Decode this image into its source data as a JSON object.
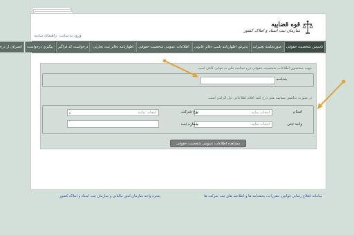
{
  "header": {
    "logo_title": "قوه قضاییه",
    "logo_subtitle": "سازمان ثبت اسناد و املاک کشور"
  },
  "toplinks": {
    "login": "ورود به سایت",
    "help": "راهنمای سایت"
  },
  "nav": {
    "items": [
      "تاسیس شخصیت حقوقی",
      "صورتجلسه تغییرات",
      "پذیرش اظهارنامه پلمپ دفاتر قانونی",
      "اطلاعات عمومی شخصیت حقوقی",
      "اظهارنامه دفاتر ثبت تجارتی",
      "درخواست کد فراگیر",
      "پیگیری درخواست",
      "انصراف از درخواست"
    ]
  },
  "search": {
    "hint_top": "جهت جستجوی اطلاعات شخصیت حقوقی درج شناسه ملی به تنهایی کافی است",
    "national_id_label": "شناسه ملی",
    "national_id_value": "",
    "hint_bottom": "در صورت نداشتن شناسه ملی درج کلیه اقلام اطلاعاتی ذیل الزامی است",
    "province_label": "استان",
    "province_placeholder": "انتخاب نمایید",
    "type_label": "نوع شرکت",
    "type_placeholder": "انتخاب نمایید",
    "unit_label": "واحد ثبتی",
    "unit_placeholder": "انتخاب نمایید",
    "reg_number_label": "شماره ثبت",
    "reg_number_value": "",
    "submit_label": "مشاهده اطلاعات عمومی شخصیت حقوقی"
  },
  "footer": {
    "right_link": "سامانه اطلاع رسانی قوانین، مقررات، بخشنامه ها و اطلاعیه های ثبت شرکت ها",
    "left_link": "پنجره واحد سازمان امور مالیاتی و سازمان ثبت اسناد و املاک کشور"
  },
  "colors": {
    "background": "#d3e0da",
    "nav": "#4d5c54",
    "panel": "#d4ddd8",
    "arrow": "#e0a33b",
    "link": "#4a6fb2"
  }
}
